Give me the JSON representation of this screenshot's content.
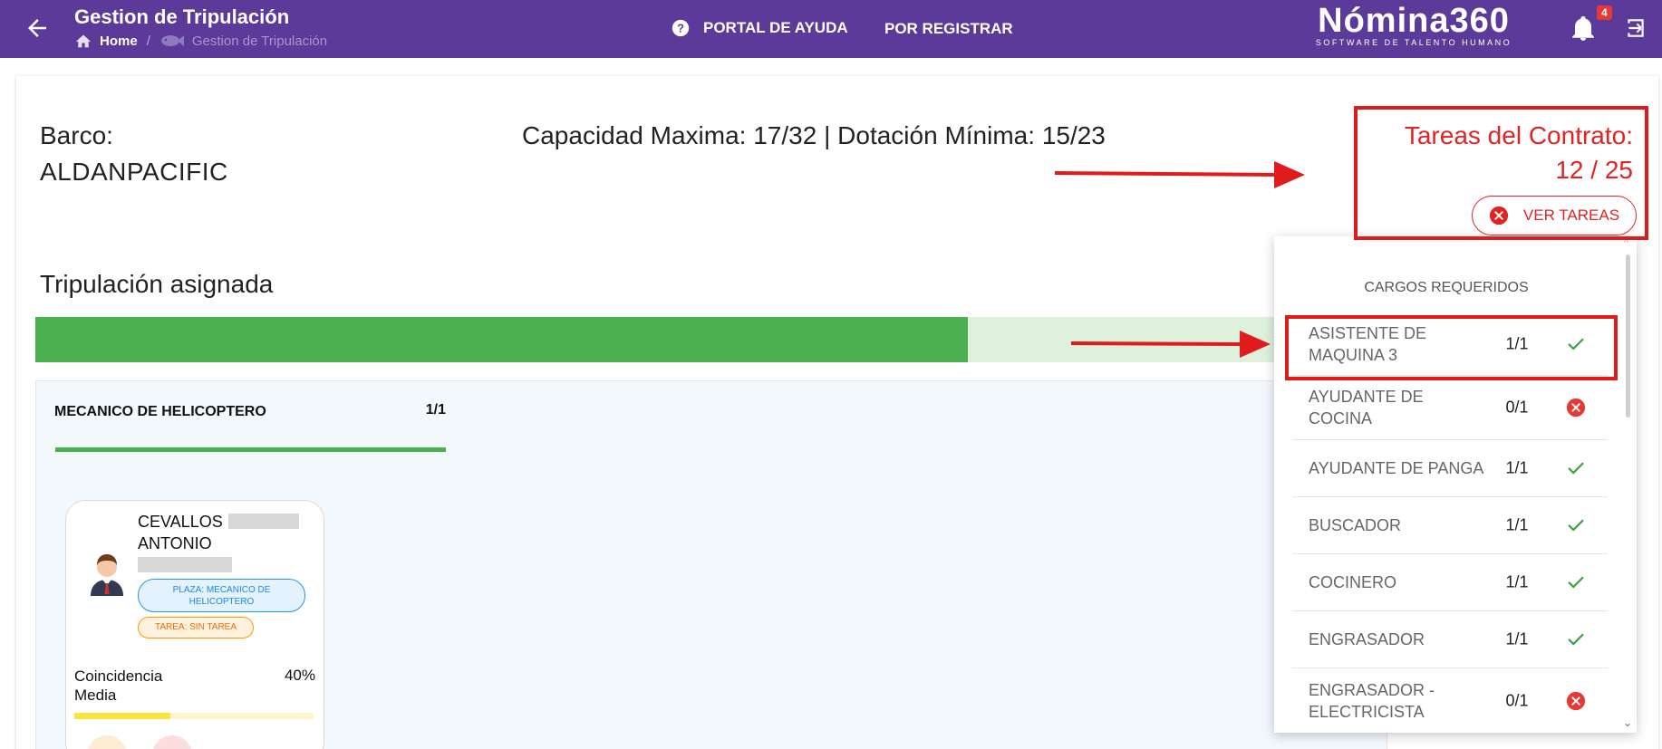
{
  "header": {
    "title": "Gestion de Tripulación",
    "breadcrumb": {
      "home": "Home",
      "current": "Gestion de Tripulación"
    },
    "nav": {
      "help": "PORTAL DE AYUDA",
      "register": "POR REGISTRAR"
    },
    "brand": {
      "name": "Nómina360",
      "tagline": "SOFTWARE DE TALENTO HUMANO"
    },
    "notifications_count": "4"
  },
  "ship": {
    "label": "Barco:",
    "name": "ALDANPACIFIC",
    "capacity_label": "Capacidad Maxima:",
    "capacity_value": "17/32",
    "separator": "|",
    "min_crew_label": "Dotación Mínima:",
    "min_crew_value": "15/23"
  },
  "tasks": {
    "label": "Tareas del Contrato:",
    "value": "12 / 25",
    "button_label": "VER TAREAS"
  },
  "crew": {
    "title": "Tripulación asignada",
    "progress_fraction": 0.69,
    "group": {
      "name": "MECANICO DE HELICOPTERO",
      "count": "1/1"
    },
    "member": {
      "name": "CEVALLOS\nANTONIO",
      "plaza_chip": "PLAZA: MECANICO DE HELICOPTERO",
      "tarea_chip": "TAREA: SIN TAREA",
      "match_label": "Coincidencia Media",
      "match_value": "40%",
      "match_fraction": 0.4
    }
  },
  "dropdown": {
    "title": "CARGOS REQUERIDOS",
    "rows": [
      {
        "name": "ASISTENTE DE MAQUINA 3",
        "count": "1/1",
        "status": "ok"
      },
      {
        "name": "AYUDANTE DE COCINA",
        "count": "0/1",
        "status": "missing"
      },
      {
        "name": "AYUDANTE DE PANGA",
        "count": "1/1",
        "status": "ok"
      },
      {
        "name": "BUSCADOR",
        "count": "1/1",
        "status": "ok"
      },
      {
        "name": "COCINERO",
        "count": "1/1",
        "status": "ok"
      },
      {
        "name": "ENGRASADOR",
        "count": "1/1",
        "status": "ok"
      },
      {
        "name": "ENGRASADOR - ELECTRICISTA",
        "count": "0/1",
        "status": "missing"
      }
    ]
  },
  "colors": {
    "header_bg": "#5b3a99",
    "accent_red": "#e02424",
    "success_green": "#4caf50",
    "annotation_red": "#e01b1b"
  }
}
